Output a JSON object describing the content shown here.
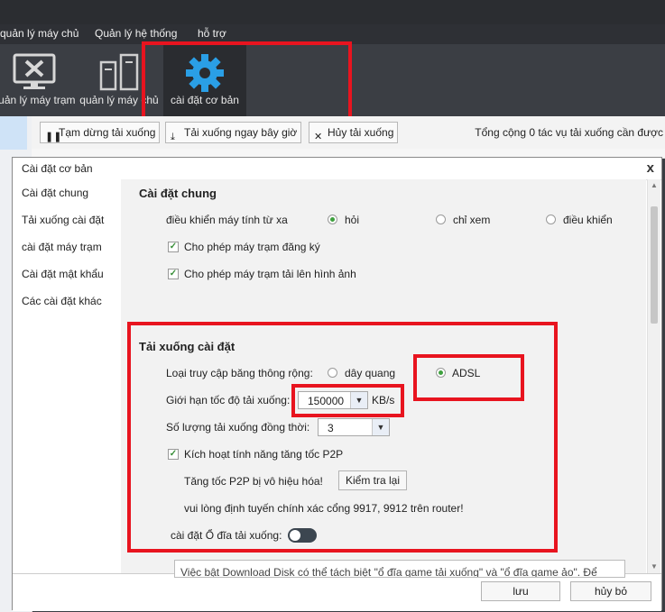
{
  "menu": {
    "item1": "quản lý máy chủ",
    "item2": "Quản lý hệ thống",
    "item3": "hỗ trợ"
  },
  "toolbar": {
    "station": "quản lý máy trạm",
    "server": "quản lý máy chủ",
    "settings": "cài đặt cơ bản"
  },
  "actions": {
    "pause": "Tạm dừng tải xuống",
    "download_now": "Tải xuống ngay bây giờ",
    "cancel": "Hủy tải xuống",
    "summary": "Tổng cộng 0 tác vụ tải xuống cần được"
  },
  "dialog": {
    "title": "Cài đặt cơ bản",
    "close": "x",
    "nav": [
      "Cài đặt chung",
      "Tải xuống cài đặt",
      "cài đặt máy trạm",
      "Cài đặt mật khẩu",
      "Các cài đặt khác"
    ],
    "general": {
      "heading": "Cài đặt chung",
      "remote_label": "điều khiển máy tính từ xa",
      "remote_options": [
        "hỏi",
        "chỉ xem",
        "điều khiển"
      ],
      "remote_selected": "hỏi",
      "allow_register": "Cho phép máy trạm đăng ký",
      "allow_upload": "Cho phép máy trạm tải lên hình ảnh"
    },
    "download": {
      "heading": "Tải xuống cài đặt",
      "bandwidth_label": "Loại truy cập băng thông rộng:",
      "bandwidth_options": [
        "dây quang",
        "ADSL"
      ],
      "bandwidth_selected": "ADSL",
      "speed_label": "Giới hạn tốc độ tải xuống:",
      "speed_value": "150000",
      "speed_unit": "KB/s",
      "concurrent_label": "Số lượng tải xuống đồng thời:",
      "concurrent_value": "3",
      "p2p_label": "Kích hoạt tính năng tăng tốc P2P",
      "p2p_status": "Tăng tốc P2P bị vô hiệu hóa!",
      "check_button": "Kiểm tra lại",
      "router_note": "vui lòng định tuyến chính xác cổng 9917, 9912 trên router!",
      "disk_label": "cài đặt Ổ đĩa tải xuống:"
    },
    "tooltip": "Việc bật Download Disk có thể tách biệt \"ổ đĩa game tải xuống\" và \"ổ đĩa game ảo\". Để",
    "save": "lưu",
    "cancel": "hủy bỏ"
  },
  "colors": {
    "highlight": "#e8141f",
    "radio_on": "#3ea03e"
  }
}
